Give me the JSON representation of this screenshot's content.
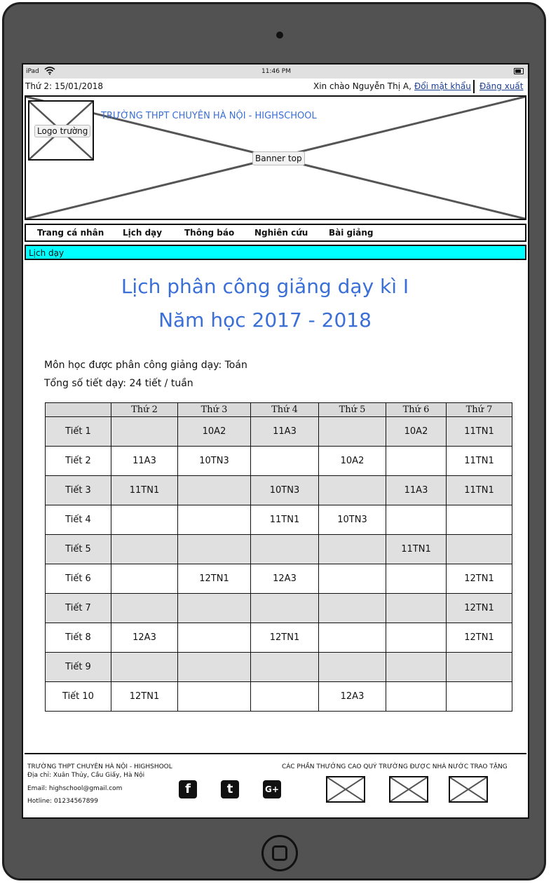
{
  "status_bar": {
    "carrier": "iPad",
    "time": "11:46 PM"
  },
  "top_bar": {
    "date": "Thứ 2: 15/01/2018",
    "greeting": "Xin chào Nguyễn Thị A,",
    "change_password": "Đổi mật khẩu",
    "logout": "Đăng xuất"
  },
  "banner": {
    "logo_label": "Logo trường",
    "school_name": "TRƯỜNG THPT CHUYÊN HÀ NỘI - HIGHSCHOOL",
    "banner_label": "Banner top"
  },
  "nav": {
    "items": [
      "Trang cá nhân",
      "Lịch dạy",
      "Thông báo",
      "Nghiên cứu",
      "Bài giảng"
    ]
  },
  "breadcrumb": "Lịch dạy",
  "page": {
    "title_line1": "Lịch phân công giảng dạy kì I",
    "title_line2": "Năm học 2017 - 2018",
    "subject": "Môn học được phân công giảng dạy: Toán",
    "total": "Tổng số tiết dạy: 24 tiết / tuần"
  },
  "schedule": {
    "headers": [
      "",
      "Thứ 2",
      "Thứ 3",
      "Thứ 4",
      "Thứ 5",
      "Thứ 6",
      "Thứ 7"
    ],
    "rows": [
      [
        "Tiết 1",
        "",
        "10A2",
        "11A3",
        "",
        "10A2",
        "11TN1"
      ],
      [
        "Tiết 2",
        "11A3",
        "10TN3",
        "",
        "10A2",
        "",
        "11TN1"
      ],
      [
        "Tiết 3",
        "11TN1",
        "",
        "10TN3",
        "",
        "11A3",
        "11TN1"
      ],
      [
        "Tiết 4",
        "",
        "",
        "11TN1",
        "10TN3",
        "",
        ""
      ],
      [
        "Tiết 5",
        "",
        "",
        "",
        "",
        "11TN1",
        ""
      ],
      [
        "Tiết 6",
        "",
        "12TN1",
        "12A3",
        "",
        "",
        "12TN1"
      ],
      [
        "Tiết 7",
        "",
        "",
        "",
        "",
        "",
        "12TN1"
      ],
      [
        "Tiết 8",
        "12A3",
        "",
        "12TN1",
        "",
        "",
        "12TN1"
      ],
      [
        "Tiết 9",
        "",
        "",
        "",
        "",
        "",
        ""
      ],
      [
        "Tiết 10",
        "12TN1",
        "",
        "",
        "12A3",
        "",
        ""
      ]
    ]
  },
  "footer": {
    "school_name": "TRƯỜNG THPT CHUYÊN HÀ NỘI - HIGHSHOOL",
    "address": "Địa chỉ: Xuân Thủy, Cầu Giấy, Hà Nội",
    "email": "Email: highschool@gmail.com",
    "hotline": "Hotline: 01234567899",
    "awards_title": "CÁC PHẦN THƯỞNG CAO QUÝ TRƯỜNG ĐƯỢC NHÀ NƯỚC TRAO TẶNG",
    "social_icons": [
      "facebook-icon",
      "tumblr-icon",
      "google-plus-icon"
    ]
  }
}
